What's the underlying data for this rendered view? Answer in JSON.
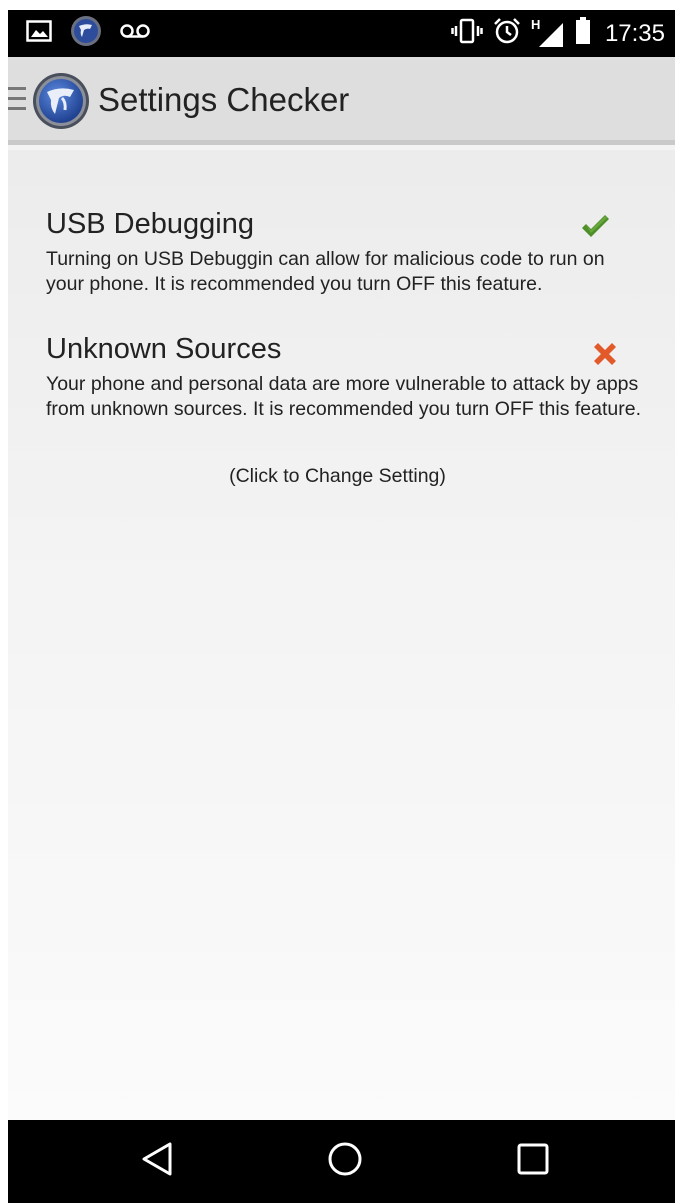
{
  "status_bar": {
    "time": "17:35",
    "network_type": "H",
    "icons": [
      "image-icon",
      "owasp-app-icon",
      "voicemail-icon",
      "vibrate-icon",
      "alarm-icon",
      "signal-icon",
      "battery-icon"
    ]
  },
  "action_bar": {
    "title": "Settings Checker"
  },
  "settings": [
    {
      "title": "USB Debugging",
      "description": "Turning on USB Debuggin can allow for malicious code to run on your phone. It is recommended you turn OFF this feature.",
      "status": "check-icon",
      "status_color": "#4e8f2a"
    },
    {
      "title": "Unknown Sources",
      "description": "Your phone and personal data are more vulnerable to attack by apps from unknown sources. It is recommended you turn OFF this feature.",
      "status": "cross-icon",
      "status_color": "#e25a2a"
    }
  ],
  "hint": "(Click to Change Setting)",
  "nav_bar": {
    "buttons": [
      "back-icon",
      "home-icon",
      "recents-icon"
    ]
  },
  "colors": {
    "status_bar_bg": "#000000",
    "action_bar_bg": "#dedede",
    "content_bg": "#f3f3f3",
    "check": "#4e8f2a",
    "cross": "#e25a2a"
  }
}
